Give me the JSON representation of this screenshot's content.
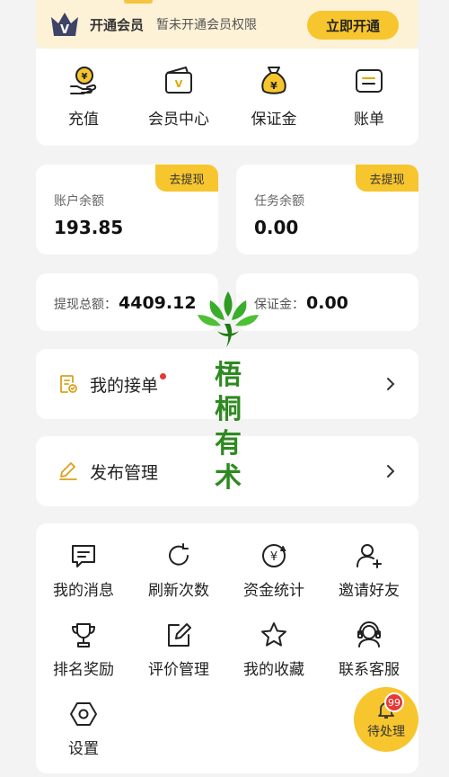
{
  "vip": {
    "title": "开通会员",
    "desc": "暂未开通会员权限",
    "button": "立即开通",
    "crown_letter": "V"
  },
  "quick_actions": [
    {
      "label": "充值",
      "icon": "recharge-icon"
    },
    {
      "label": "会员中心",
      "icon": "member-center-icon"
    },
    {
      "label": "保证金",
      "icon": "deposit-bag-icon"
    },
    {
      "label": "账单",
      "icon": "bill-icon"
    }
  ],
  "balances": {
    "account": {
      "label": "账户余额",
      "value": "193.85",
      "tag": "去提现"
    },
    "task": {
      "label": "任务余额",
      "value": "0.00",
      "tag": "去提现"
    }
  },
  "totals": {
    "withdraw_label": "提现总额：",
    "withdraw_value": "4409.12",
    "deposit_label": "保证金：",
    "deposit_value": "0.00"
  },
  "menu": {
    "orders": "我的接单",
    "publish": "发布管理"
  },
  "grid": [
    {
      "label": "我的消息",
      "icon": "message-icon"
    },
    {
      "label": "刷新次数",
      "icon": "refresh-icon"
    },
    {
      "label": "资金统计",
      "icon": "funds-stats-icon"
    },
    {
      "label": "邀请好友",
      "icon": "invite-user-icon"
    },
    {
      "label": "排名奖励",
      "icon": "trophy-icon"
    },
    {
      "label": "评价管理",
      "icon": "edit-review-icon"
    },
    {
      "label": "我的收藏",
      "icon": "star-icon"
    },
    {
      "label": "联系客服",
      "icon": "support-icon"
    },
    {
      "label": "设置",
      "icon": "settings-icon"
    }
  ],
  "pending": {
    "label": "待处理",
    "badge": "99"
  },
  "watermark": {
    "chars": [
      "梧",
      "桐",
      "有",
      "术"
    ]
  },
  "colors": {
    "accent": "#f7c52e",
    "banner_bg": "#fdf1d6",
    "badge": "#e53935",
    "watermark": "#2e8a20",
    "page_bg": "#f3f3f3"
  }
}
